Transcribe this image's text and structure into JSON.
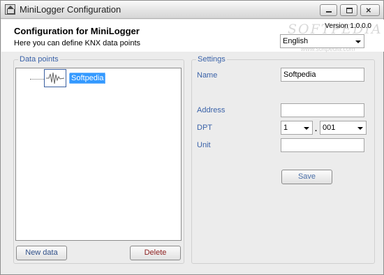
{
  "window": {
    "title": "MiniLogger Configuration",
    "close_glyph": "×"
  },
  "header": {
    "title": "Configuration for MiniLogger",
    "subtitle": "Here you can define KNX data points",
    "version": "Version 1.0.0.0",
    "language": "English",
    "watermark": "SOFTPEDIA",
    "watermark_url": "www.softpedia.com"
  },
  "data_points": {
    "legend": "Data points",
    "items": [
      {
        "label": "Softpedia",
        "icon": "waveform-icon"
      }
    ],
    "new_button": "New data",
    "delete_button": "Delete"
  },
  "settings": {
    "legend": "Settings",
    "name_label": "Name",
    "name_value": "Softpedia",
    "address_label": "Address",
    "address_value": "",
    "dpt_label": "DPT",
    "dpt_main": "1",
    "dpt_separator": ".",
    "dpt_sub": "001",
    "unit_label": "Unit",
    "unit_value": "",
    "save_button": "Save"
  }
}
